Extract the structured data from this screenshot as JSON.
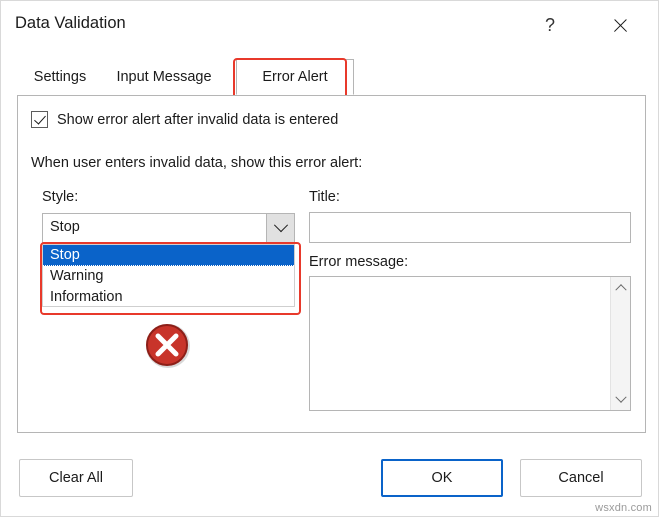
{
  "window": {
    "title": "Data Validation",
    "help_label": "?",
    "close_label": "close-icon"
  },
  "tabs": [
    {
      "label": "Settings",
      "selected": false
    },
    {
      "label": "Input Message",
      "selected": false
    },
    {
      "label": "Error Alert",
      "selected": true
    }
  ],
  "highlight_color": "#e8392b",
  "accent_color": "#0a63c9",
  "panel": {
    "checkbox": {
      "label": "Show error alert after invalid data is entered",
      "checked": true
    },
    "instruction": "When user enters invalid data, show this error alert:",
    "style": {
      "label": "Style:",
      "value": "Stop",
      "options": [
        {
          "label": "Stop",
          "selected": true
        },
        {
          "label": "Warning",
          "selected": false
        },
        {
          "label": "Information",
          "selected": false
        }
      ]
    },
    "title_field": {
      "label": "Title:",
      "value": "",
      "placeholder": ""
    },
    "error_message_field": {
      "label": "Error message:",
      "value": "",
      "placeholder": ""
    },
    "icon_name": "stop-error-icon"
  },
  "footer": {
    "clear_all": "Clear All",
    "ok": "OK",
    "cancel": "Cancel"
  },
  "watermark": "wsxdn.com"
}
